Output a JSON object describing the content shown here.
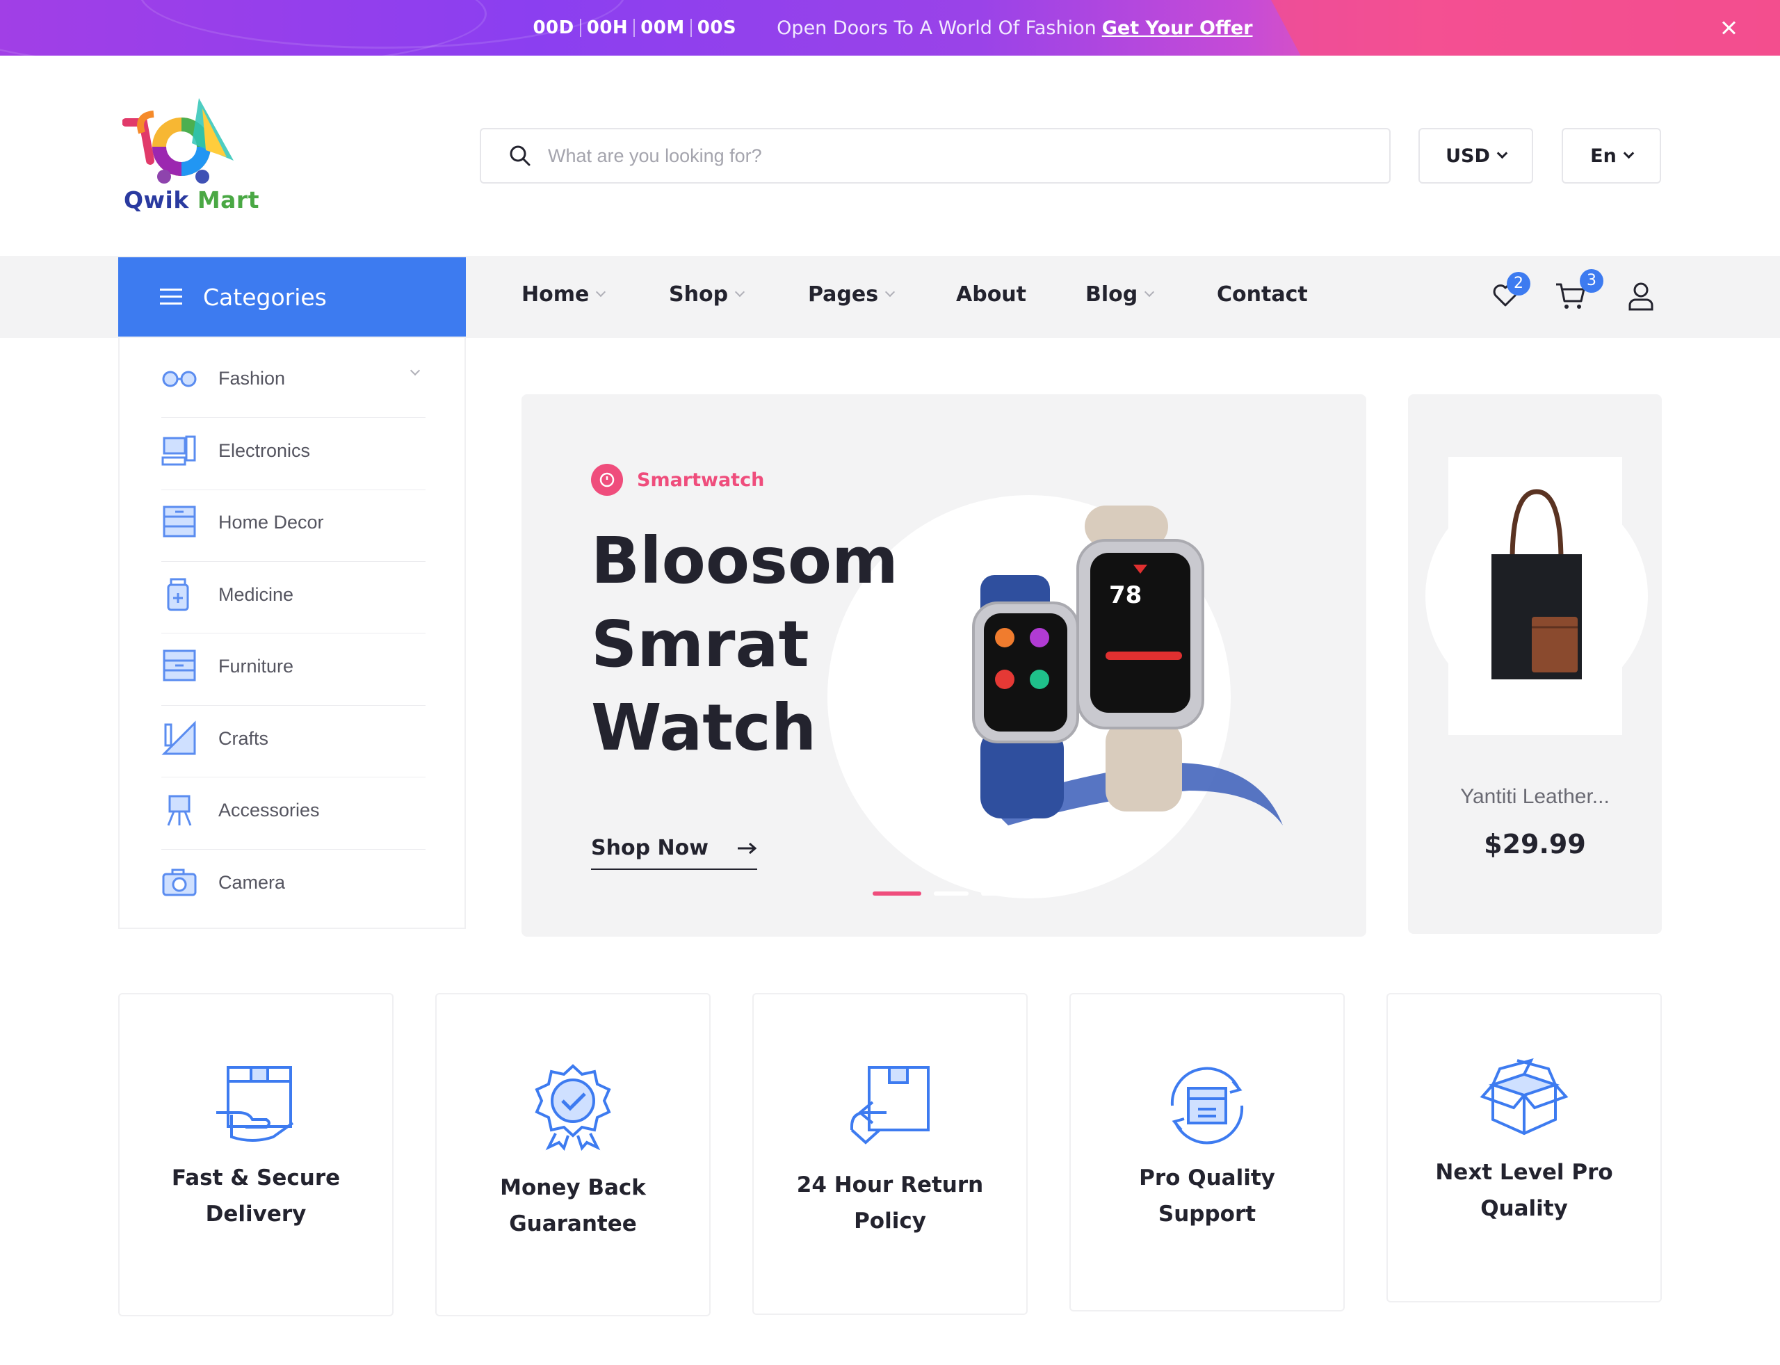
{
  "promo": {
    "timer": {
      "days": "00D",
      "hours": "00H",
      "minutes": "00M",
      "seconds": "00S"
    },
    "text": "Open Doors To A World Of Fashion",
    "link": "Get Your Offer"
  },
  "brand": {
    "name_part1": "Qwik",
    "name_part2": "Mart"
  },
  "search": {
    "placeholder": "What are you looking for?",
    "value": ""
  },
  "currency": {
    "selected": "USD"
  },
  "language": {
    "selected": "En"
  },
  "nav": {
    "categories_label": "Categories",
    "items": [
      {
        "label": "Home"
      },
      {
        "label": "Shop"
      },
      {
        "label": "Pages"
      },
      {
        "label": "About"
      },
      {
        "label": "Blog"
      },
      {
        "label": "Contact"
      }
    ],
    "wishlist_count": "2",
    "cart_count": "3"
  },
  "categories": [
    {
      "label": "Fashion",
      "icon": "glasses-icon"
    },
    {
      "label": "Electronics",
      "icon": "computer-icon"
    },
    {
      "label": "Home Decor",
      "icon": "drawer-icon"
    },
    {
      "label": "Medicine",
      "icon": "medicine-bottle-icon"
    },
    {
      "label": "Furniture",
      "icon": "cabinet-icon"
    },
    {
      "label": "Crafts",
      "icon": "ruler-pencil-icon"
    },
    {
      "label": "Accessories",
      "icon": "easel-icon"
    },
    {
      "label": "Camera",
      "icon": "camera-icon"
    }
  ],
  "hero": {
    "tag": "Smartwatch",
    "title_lines": [
      "Bloosom",
      "Smrat",
      "Watch"
    ],
    "cta": "Shop Now",
    "slides": 3,
    "active_slide": 1
  },
  "side_product": {
    "name": "Yantiti Leather...",
    "price": "$29.99"
  },
  "features": [
    {
      "line1": "Fast & Secure",
      "line2": "Delivery",
      "icon": "delivery-box-hand-icon"
    },
    {
      "line1": "Money Back",
      "line2": "Guarantee",
      "icon": "badge-check-icon"
    },
    {
      "line1": "24 Hour Return",
      "line2": "Policy",
      "icon": "return-box-icon"
    },
    {
      "line1": "Pro Quality",
      "line2": "Support",
      "icon": "support-box-icon"
    },
    {
      "line1": "Next Level Pro",
      "line2": "Quality",
      "icon": "open-box-icon"
    }
  ],
  "colors": {
    "accent_blue": "#3d7bf0",
    "accent_pink": "#ef4d7c",
    "text_dark": "#23232e"
  }
}
